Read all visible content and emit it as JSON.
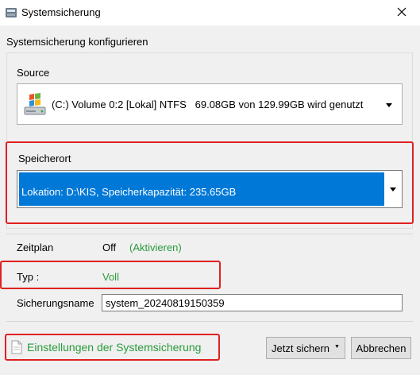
{
  "window": {
    "title": "Systemsicherung",
    "icon": "backup-app-icon",
    "close_icon": "close-icon"
  },
  "header": {
    "section_title": "Systemsicherung konfigurieren"
  },
  "source": {
    "group_label": "Source",
    "icon": "windows-drive-icon",
    "selected_value": "(C:) Volume 0:2 [Lokal] NTFS   69.08GB von 129.99GB wird genutzt"
  },
  "destination": {
    "group_label": "Speicherort",
    "selected_value": "Lokation: D:\\KIS, Speicherkapazität: 235.65GB",
    "highlight_color": "#0078d7"
  },
  "settings": {
    "schedule_label": "Zeitplan",
    "schedule_value": "Off",
    "schedule_action": "(Aktivieren)",
    "type_label": "Typ :",
    "type_value": "Voll",
    "backup_name_label": "Sicherungsname",
    "backup_name_value": "system_20240819150359"
  },
  "footer": {
    "settings_link": "Einstellungen der Systemsicherung",
    "backup_now_button": "Jetzt sichern",
    "cancel_button": "Abbrechen"
  },
  "colors": {
    "accent_green": "#2a9b3a",
    "annotation_red": "#e02020",
    "selection_blue": "#0078d7"
  }
}
